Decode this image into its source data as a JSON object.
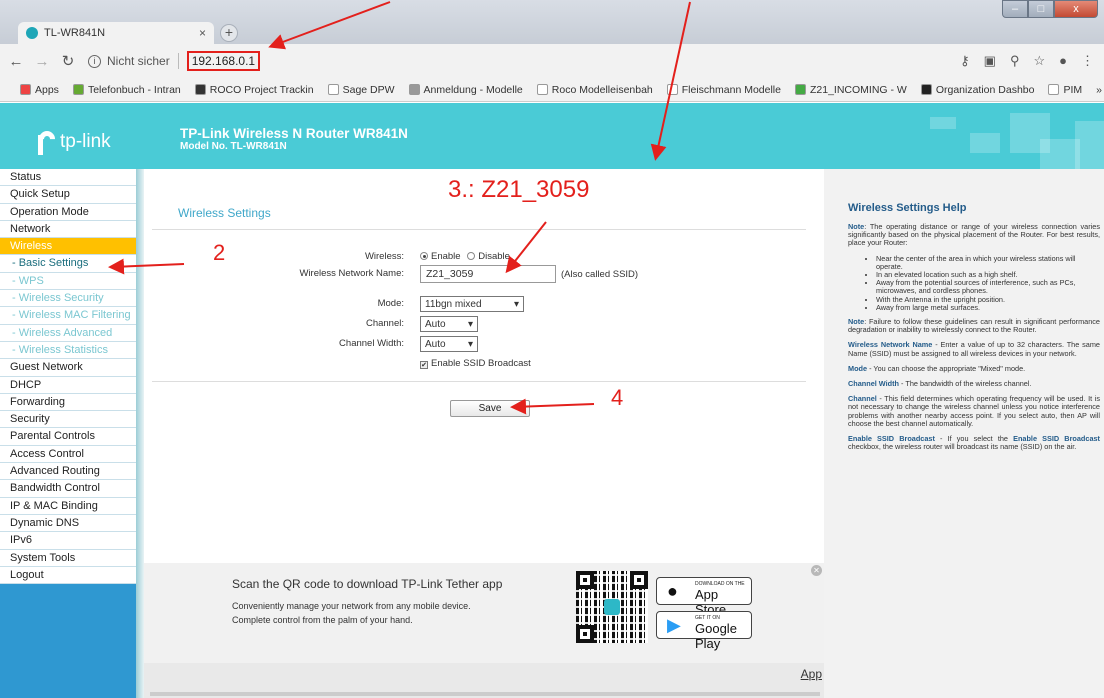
{
  "browser": {
    "tab_title": "TL-WR841N",
    "tab_close": "×",
    "new_tab": "+",
    "security_label": "Nicht sicher",
    "url": "192.168.0.1",
    "window_controls": {
      "minimize": "–",
      "maximize": "□",
      "close": "x"
    },
    "bookmarks": [
      {
        "label": "Apps",
        "icon": "apps-grid-icon",
        "color": "#e44"
      },
      {
        "label": "Telefonbuch - Intran",
        "icon": "phonebook-icon",
        "color": "#6a3"
      },
      {
        "label": "ROCO Project Trackin",
        "icon": "roco-icon",
        "color": "#333"
      },
      {
        "label": "Sage DPW",
        "icon": "page-icon",
        "color": "#fff"
      },
      {
        "label": "Anmeldung - Modelle",
        "icon": "star-burst-icon",
        "color": "#999"
      },
      {
        "label": "Roco Modelleisenbah",
        "icon": "page-icon",
        "color": "#fff"
      },
      {
        "label": "Fleischmann Modelle",
        "icon": "page-icon",
        "color": "#fff"
      },
      {
        "label": "Z21_INCOMING - W",
        "icon": "checkmark-icon",
        "color": "#4a4"
      },
      {
        "label": "Organization Dashbo",
        "icon": "u-logo-icon",
        "color": "#222"
      },
      {
        "label": "PIM",
        "icon": "page-icon",
        "color": "#fff"
      }
    ],
    "bookmarks_more": "»"
  },
  "router": {
    "brand": "tp-link",
    "title": "TP-Link Wireless N Router WR841N",
    "model": "Model No. TL-WR841N"
  },
  "sidebar": {
    "items": [
      {
        "label": "Status",
        "type": "top"
      },
      {
        "label": "Quick Setup",
        "type": "top"
      },
      {
        "label": "Operation Mode",
        "type": "top"
      },
      {
        "label": "Network",
        "type": "top"
      },
      {
        "label": "Wireless",
        "type": "active"
      },
      {
        "label": "- Basic Settings",
        "type": "sub-current"
      },
      {
        "label": "- WPS",
        "type": "sub"
      },
      {
        "label": "- Wireless Security",
        "type": "sub"
      },
      {
        "label": "- Wireless MAC Filtering",
        "type": "sub"
      },
      {
        "label": "- Wireless Advanced",
        "type": "sub"
      },
      {
        "label": "- Wireless Statistics",
        "type": "sub"
      },
      {
        "label": "Guest Network",
        "type": "top"
      },
      {
        "label": "DHCP",
        "type": "top"
      },
      {
        "label": "Forwarding",
        "type": "top"
      },
      {
        "label": "Security",
        "type": "top"
      },
      {
        "label": "Parental Controls",
        "type": "top"
      },
      {
        "label": "Access Control",
        "type": "top"
      },
      {
        "label": "Advanced Routing",
        "type": "top"
      },
      {
        "label": "Bandwidth Control",
        "type": "top"
      },
      {
        "label": "IP & MAC Binding",
        "type": "top"
      },
      {
        "label": "Dynamic DNS",
        "type": "top"
      },
      {
        "label": "IPv6",
        "type": "top"
      },
      {
        "label": "System Tools",
        "type": "top"
      },
      {
        "label": "Logout",
        "type": "top"
      }
    ]
  },
  "form": {
    "section_title": "Wireless Settings",
    "wireless_label": "Wireless:",
    "enable_label": "Enable",
    "disable_label": "Disable",
    "wireless_enabled": true,
    "ssid_label": "Wireless Network Name:",
    "ssid_value": "Z21_3059",
    "ssid_hint": "(Also called SSID)",
    "mode_label": "Mode:",
    "mode_value": "11bgn mixed",
    "channel_label": "Channel:",
    "channel_value": "Auto",
    "width_label": "Channel Width:",
    "width_value": "Auto",
    "broadcast_label": "Enable SSID Broadcast",
    "broadcast_checked": true,
    "save_label": "Save"
  },
  "annotations": {
    "step2": "2",
    "step3": "3.: Z21_3059",
    "step4": "4",
    "color": "#e3201c"
  },
  "promo": {
    "title": "Scan the QR code to download TP-Link Tether app",
    "line1": "Conveniently manage your network from any mobile device.",
    "line2": "Complete control from the palm of your hand.",
    "appstore_small": "DOWNLOAD ON THE",
    "appstore_big": "App Store",
    "googleplay_small": "GET IT ON",
    "googleplay_big": "Google Play",
    "app_link": "App"
  },
  "help": {
    "title": "Wireless Settings Help",
    "note1_label": "Note",
    "note1_text": ": The operating distance or range of your wireless connection varies significantly based on the physical placement of the Router. For best results, place your Router:",
    "bullets": [
      "Near the center of the area in which your wireless stations will operate.",
      "In an elevated location such as a high shelf.",
      "Away from the potential sources of interference, such as PCs, microwaves, and cordless phones.",
      "With the Antenna in the upright position.",
      "Away from large metal surfaces."
    ],
    "note2_label": "Note",
    "note2_text": ": Failure to follow these guidelines can result in significant performance degradation or inability to wirelessly connect to the Router.",
    "ssid_label": "Wireless Network Name",
    "ssid_text": " - Enter a value of up to 32 characters. The same Name (SSID) must be assigned to all wireless devices in your network.",
    "mode_label": "Mode",
    "mode_text": " - You can choose the appropriate \"Mixed\" mode.",
    "width_label": "Channel Width",
    "width_text": " - The bandwidth of the wireless channel.",
    "channel_label": "Channel",
    "channel_text": " - This field determines which operating frequency will be used. It is not necessary to change the wireless channel unless you notice interference problems with another nearby access point. If you select auto, then AP will choose the best channel automatically.",
    "bc_label": "Enable SSID Broadcast",
    "bc_text_a": " - If you select the ",
    "bc_label2": "Enable SSID Broadcast",
    "bc_text_b": " checkbox, the wireless router will broadcast its name (SSID) on the air."
  }
}
